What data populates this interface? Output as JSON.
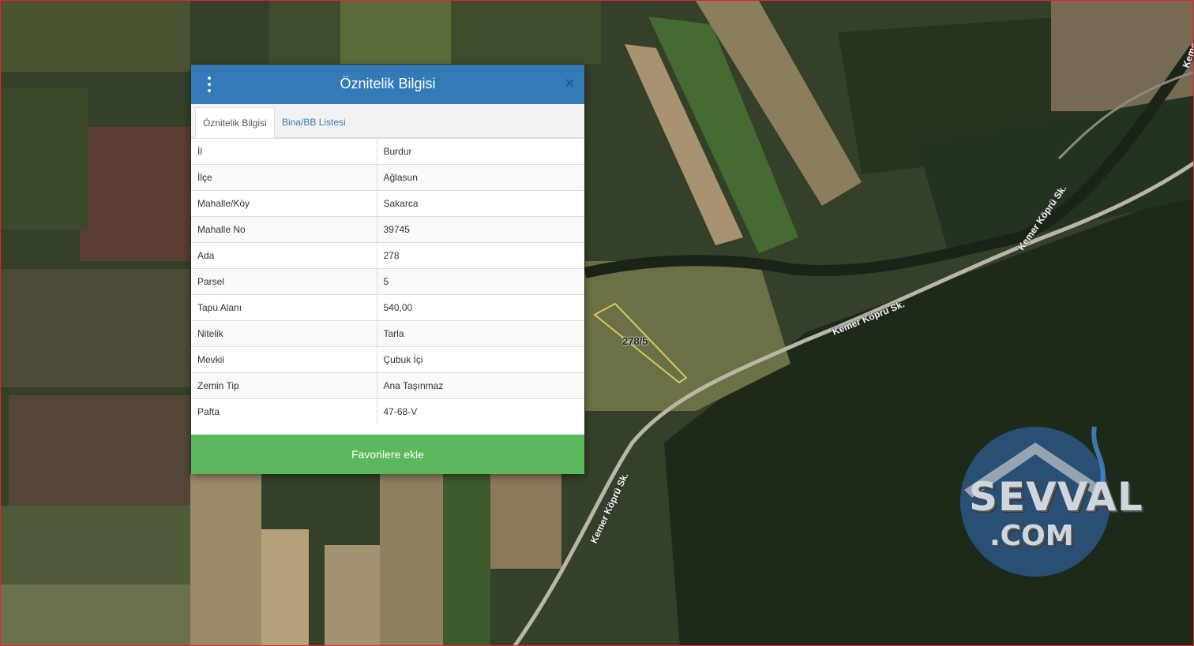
{
  "map": {
    "road_labels": [
      "Kemer Köprü Sk.",
      "Kemer Köprü Sk.",
      "Kemer Köprü Sk.",
      "Kemer"
    ],
    "parcel_label": "278/5",
    "watermark": {
      "line1": "SEVVAL",
      "line2": ".COM"
    },
    "colors": {
      "parcel_outline": "#d7c75a",
      "frame": "#e0262a"
    }
  },
  "dialog": {
    "title": "Öznitelik Bilgisi",
    "close_symbol": "×",
    "tabs": [
      {
        "label": "Öznitelik Bilgisi",
        "active": true
      },
      {
        "label": "Bina/BB Listesi",
        "active": false
      }
    ],
    "rows": [
      {
        "key": "İl",
        "value": "Burdur"
      },
      {
        "key": "İlçe",
        "value": "Ağlasun"
      },
      {
        "key": "Mahalle/Köy",
        "value": "Sakarca"
      },
      {
        "key": "Mahalle No",
        "value": "39745"
      },
      {
        "key": "Ada",
        "value": "278"
      },
      {
        "key": "Parsel",
        "value": "5"
      },
      {
        "key": "Tapu Alanı",
        "value": "540,00"
      },
      {
        "key": "Nitelik",
        "value": "Tarla"
      },
      {
        "key": "Mevkii",
        "value": "Çubuk İçi"
      },
      {
        "key": "Zemin Tip",
        "value": "Ana Taşınmaz"
      },
      {
        "key": "Pafta",
        "value": "47-68-V"
      }
    ],
    "favorite_button": "Favorilere ekle",
    "colors": {
      "header": "#337ab7",
      "favorite": "#5cb85c"
    }
  }
}
